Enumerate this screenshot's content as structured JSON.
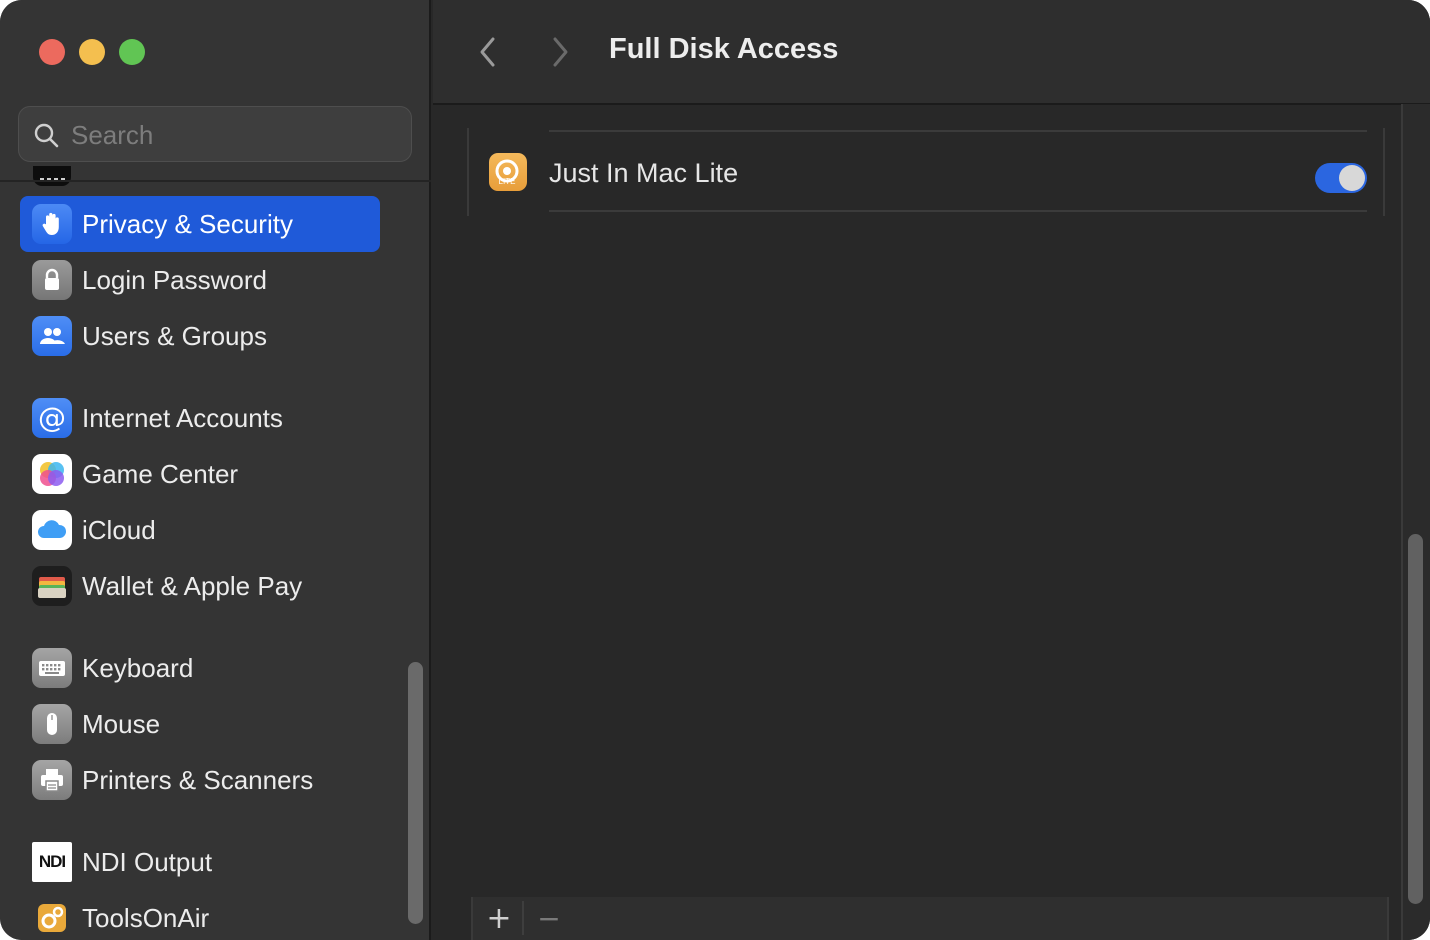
{
  "window": {
    "controls": [
      "close",
      "minimize",
      "zoom"
    ]
  },
  "sidebar": {
    "search": {
      "placeholder": "Search",
      "value": ""
    },
    "items": [
      {
        "label": "Privacy & Security",
        "icon": "hand-icon",
        "selected": true
      },
      {
        "label": "Login Password",
        "icon": "lock-icon"
      },
      {
        "label": "Users & Groups",
        "icon": "users-icon"
      },
      {
        "label": "Internet Accounts",
        "icon": "at-sign-icon"
      },
      {
        "label": "Game Center",
        "icon": "game-center-icon"
      },
      {
        "label": "iCloud",
        "icon": "cloud-icon"
      },
      {
        "label": "Wallet & Apple Pay",
        "icon": "wallet-icon"
      },
      {
        "label": "Keyboard",
        "icon": "keyboard-icon"
      },
      {
        "label": "Mouse",
        "icon": "mouse-icon"
      },
      {
        "label": "Printers & Scanners",
        "icon": "printer-icon"
      },
      {
        "label": "NDI Output",
        "icon": "ndi-logo-icon",
        "icon_text": "NDI"
      },
      {
        "label": "ToolsOnAir",
        "icon": "gears-icon"
      }
    ]
  },
  "header": {
    "title": "Full Disk Access"
  },
  "apps": [
    {
      "name": "Just In Mac Lite",
      "icon": "just-in-mac-lite-icon",
      "icon_text": "LITE",
      "enabled": true
    }
  ],
  "bottom_bar": {
    "add_label": "+",
    "remove_label": "−"
  },
  "colors": {
    "accent": "#1f5ad9",
    "toggle_on": "#2b66e0",
    "sidebar_bg": "#343434",
    "content_bg": "#282828"
  }
}
